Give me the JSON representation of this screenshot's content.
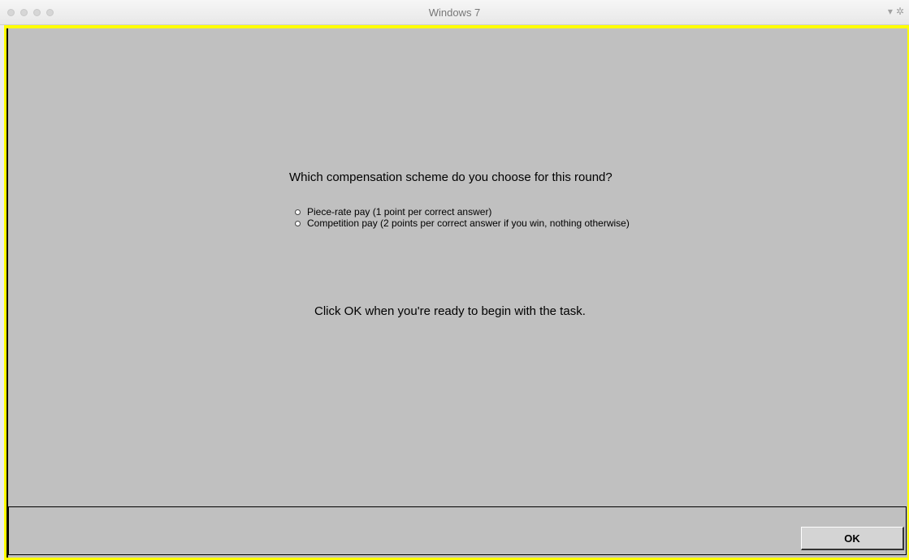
{
  "window": {
    "title": "Windows 7",
    "controls_icons": [
      "chevron-down-icon",
      "gear-icon"
    ]
  },
  "colors": {
    "frame_border": "#ffff00",
    "panel_background": "#c0c0c0"
  },
  "main": {
    "question": "Which compensation scheme do you choose for this round?",
    "options": [
      {
        "label": "Piece-rate pay (1 point per correct answer)",
        "selected": false
      },
      {
        "label": "Competition pay (2 points per correct answer if you win, nothing otherwise)",
        "selected": false
      }
    ],
    "instruction": "Click OK when you're ready to begin with the task."
  },
  "footer": {
    "ok_label": "OK"
  }
}
